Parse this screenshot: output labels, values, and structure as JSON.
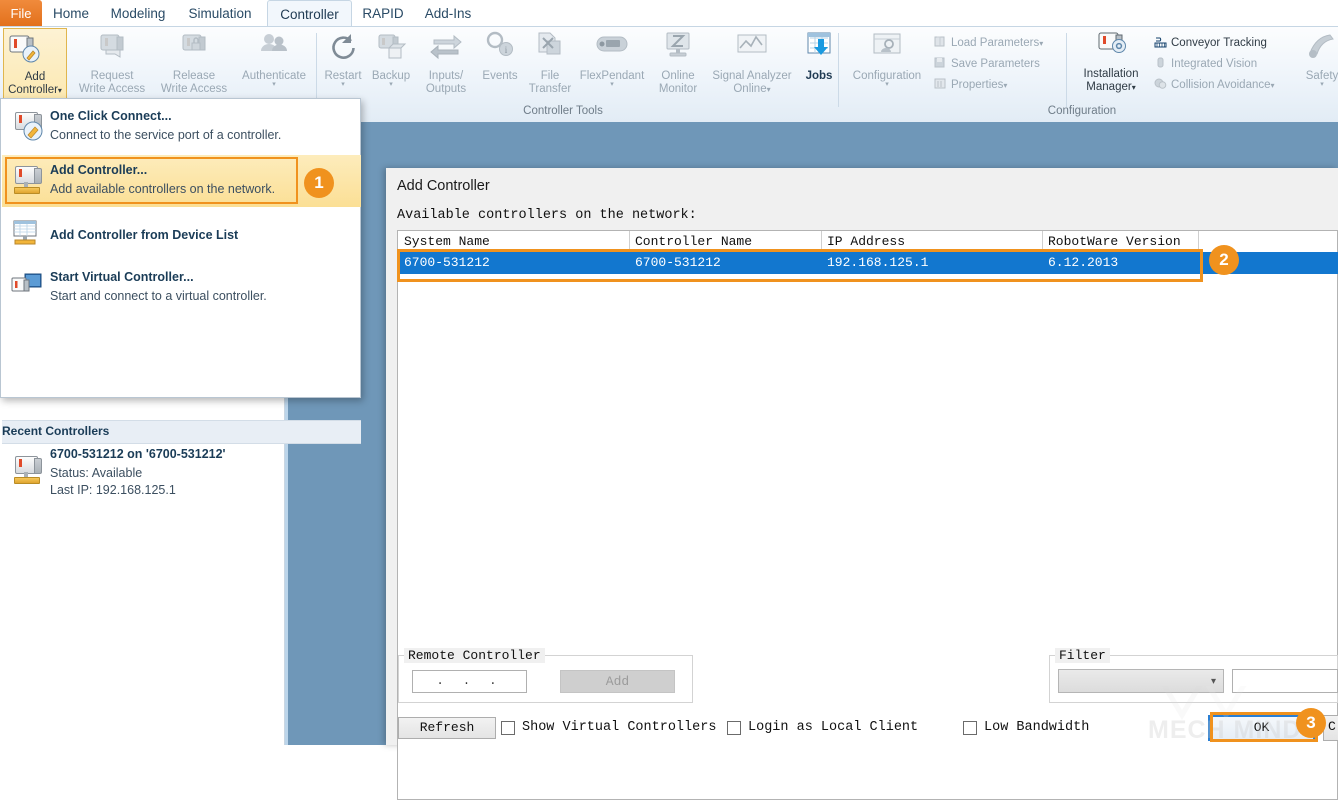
{
  "ribbon": {
    "tabs": [
      {
        "label": "File",
        "state": "file"
      },
      {
        "label": "Home",
        "state": "normal"
      },
      {
        "label": "Modeling",
        "state": "normal"
      },
      {
        "label": "Simulation",
        "state": "normal"
      },
      {
        "label": "Controller",
        "state": "active"
      },
      {
        "label": "RAPID",
        "state": "normal"
      },
      {
        "label": "Add-Ins",
        "state": "normal"
      }
    ],
    "access_group": {
      "add_controller": {
        "line1": "Add",
        "line2": "Controller",
        "caret": "▾",
        "icon": "add-controller-icon"
      },
      "request_write_access": {
        "line1": "Request",
        "line2": "Write Access",
        "icon": "request-write-access-icon"
      },
      "release_write_access": {
        "line1": "Release",
        "line2": "Write Access",
        "icon": "release-write-access-icon"
      },
      "authenticate": {
        "line1": "Authenticate",
        "line2": "",
        "caret": "▾",
        "icon": "authenticate-icon"
      }
    },
    "controller_tools": {
      "group_label": "Controller Tools",
      "items": [
        {
          "line1": "Restart",
          "line2": "",
          "caret": "▾",
          "icon": "restart-icon",
          "enabled": false
        },
        {
          "line1": "Backup",
          "line2": "",
          "caret": "▾",
          "icon": "backup-icon",
          "enabled": false
        },
        {
          "line1": "Inputs/",
          "line2": "Outputs",
          "caret": "",
          "icon": "inputs-outputs-icon",
          "enabled": false
        },
        {
          "line1": "Events",
          "line2": "",
          "caret": "",
          "icon": "events-icon",
          "enabled": false
        },
        {
          "line1": "File",
          "line2": "Transfer",
          "caret": "",
          "icon": "file-transfer-icon",
          "enabled": false
        },
        {
          "line1": "FlexPendant",
          "line2": "",
          "caret": "▾",
          "icon": "flexpendant-icon",
          "enabled": false
        },
        {
          "line1": "Online",
          "line2": "Monitor",
          "caret": "",
          "icon": "online-monitor-icon",
          "enabled": false
        },
        {
          "line1": "Signal Analyzer",
          "line2": "Online",
          "caret": "▾",
          "icon": "signal-analyzer-icon",
          "enabled": false
        },
        {
          "line1": "Jobs",
          "line2": "",
          "caret": "",
          "icon": "jobs-icon",
          "enabled": true
        }
      ]
    },
    "configuration": {
      "group_label": "Configuration",
      "configuration_btn": {
        "line1": "Configuration",
        "line2": "",
        "caret": "▾",
        "icon": "configuration-icon"
      },
      "small_items": [
        {
          "label": "Load Parameters",
          "caret": "▾",
          "icon": "load-parameters-icon"
        },
        {
          "label": "Save Parameters",
          "caret": "",
          "icon": "save-parameters-icon"
        },
        {
          "label": "Properties",
          "caret": "▾",
          "icon": "properties-icon"
        }
      ],
      "installation_manager": {
        "line1": "Installation",
        "line2": "Manager",
        "caret": "▾",
        "icon": "installation-manager-icon"
      },
      "right_items": [
        {
          "label": "Conveyor Tracking",
          "caret": "",
          "icon": "conveyor-tracking-icon",
          "enabled": true
        },
        {
          "label": "Integrated Vision",
          "caret": "",
          "icon": "integrated-vision-icon",
          "enabled": false
        },
        {
          "label": "Collision Avoidance",
          "caret": "▾",
          "icon": "collision-avoidance-icon",
          "enabled": false
        }
      ],
      "safety": {
        "line1": "Safety",
        "line2": "",
        "caret": "▾",
        "icon": "safety-icon"
      }
    }
  },
  "menu": {
    "items": [
      {
        "title": "One Click Connect...",
        "subtitle": "Connect to the service port of a controller.",
        "icon": "one-click-connect-icon",
        "highlighted": false
      },
      {
        "title": "Add Controller...",
        "subtitle": "Add available controllers on the network.",
        "icon": "add-controller-icon",
        "highlighted": true
      },
      {
        "title": "Add Controller from Device List",
        "subtitle": "",
        "icon": "device-list-icon",
        "highlighted": false
      },
      {
        "title": "Start Virtual Controller...",
        "subtitle": "Start and connect to a virtual controller.",
        "icon": "virtual-controller-icon",
        "highlighted": false
      }
    ],
    "recent_header": "Recent Controllers",
    "recent": {
      "title": "6700-531212 on '6700-531212'",
      "status": "Status: Available",
      "last_ip": "Last IP: 192.168.125.1",
      "icon": "controller-icon"
    }
  },
  "dialog": {
    "title": "Add Controller",
    "subtitle": "Available controllers on the network:",
    "table": {
      "columns": [
        "System Name",
        "Controller Name",
        "IP Address",
        "RobotWare Version"
      ],
      "rows": [
        {
          "system_name": "6700-531212",
          "controller_name": "6700-531212",
          "ip_address": "192.168.125.1",
          "robotware_version": "6.12.2013",
          "selected": true
        }
      ]
    },
    "remote_controller": {
      "legend": "Remote Controller",
      "ip_value": ".   .   .",
      "add_label": "Add"
    },
    "filter": {
      "legend": "Filter",
      "selected": "",
      "search_value": ""
    },
    "refresh_label": "Refresh",
    "checkboxes": [
      {
        "label": "Show Virtual Controllers",
        "checked": false
      },
      {
        "label": "Login as Local Client",
        "checked": false
      },
      {
        "label": "Low Bandwidth",
        "checked": false
      }
    ],
    "ok_label": "OK",
    "cancel_label": "C"
  },
  "badges": [
    {
      "number": "1"
    },
    {
      "number": "2"
    },
    {
      "number": "3"
    }
  ],
  "watermark": {
    "text": "MECH MIND"
  },
  "colors": {
    "accent_orange": "#f0921e",
    "file_tab": "#e2701b",
    "selection_blue": "#1277cf",
    "workspace_blue": "#6f97b8",
    "menu_highlight": "#fbdf95"
  }
}
